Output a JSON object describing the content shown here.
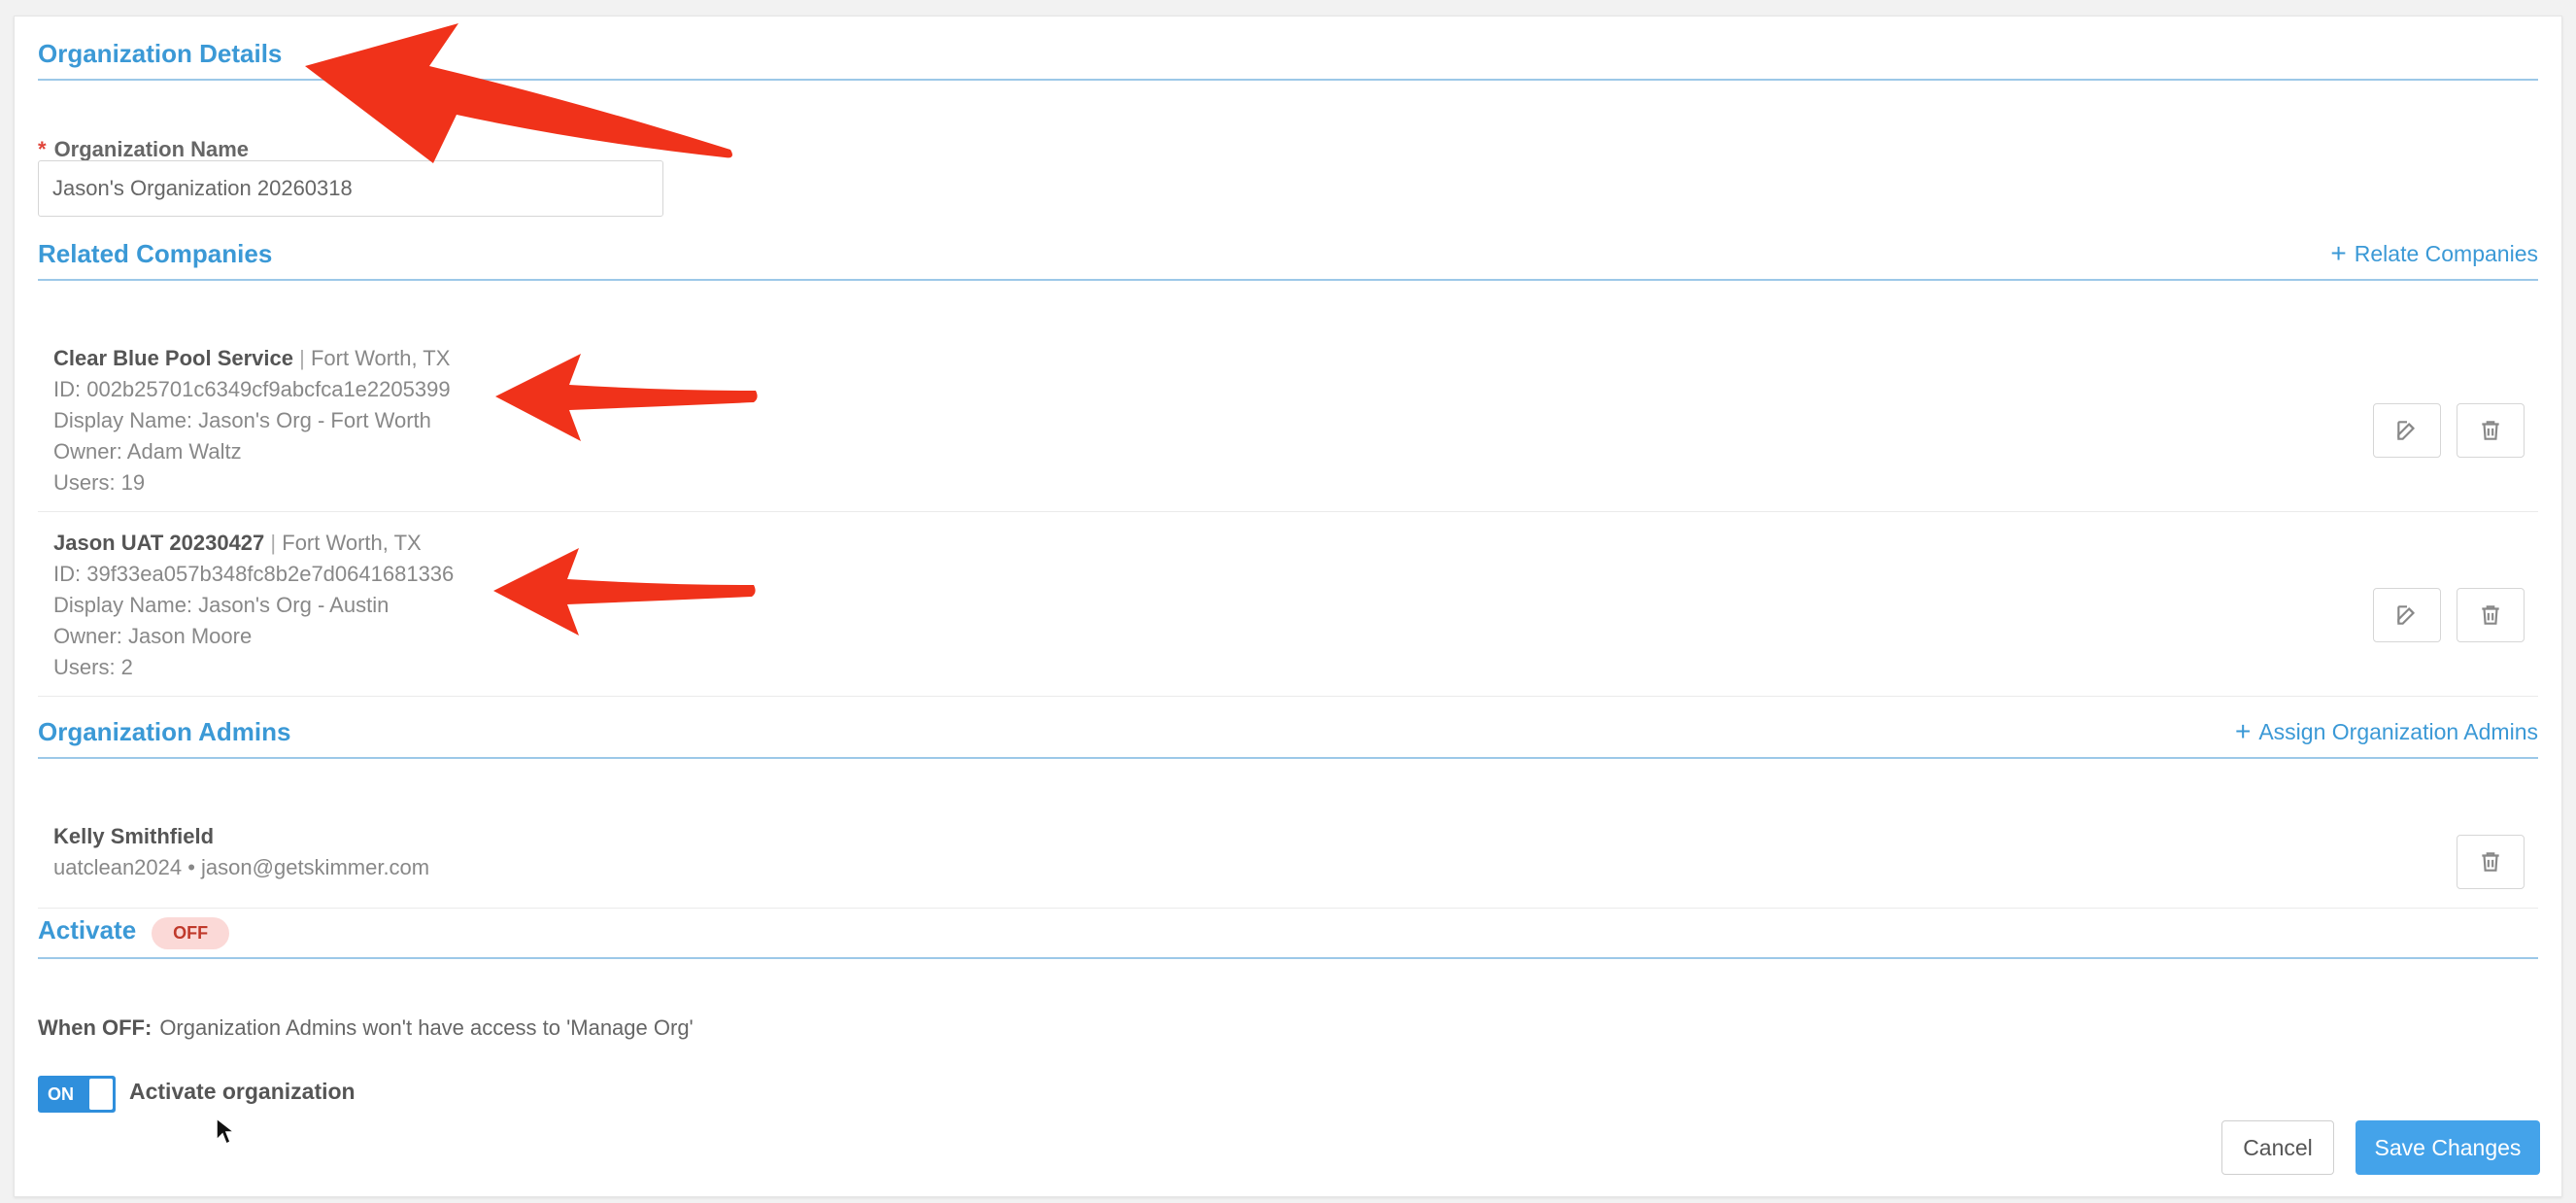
{
  "org_details": {
    "title": "Organization Details",
    "name_label": "Organization Name",
    "required_mark": "*",
    "name_value": "Jason's Organization 20260318"
  },
  "related_companies": {
    "title": "Related Companies",
    "action_label": "Relate Companies",
    "items": [
      {
        "name": "Clear Blue Pool Service",
        "sep": "|",
        "location": "Fort Worth, TX",
        "id_line": "ID: 002b25701c6349cf9abcfca1e2205399",
        "display_line": "Display Name: Jason's Org - Fort Worth",
        "owner_line": "Owner: Adam Waltz",
        "users_line": "Users: 19"
      },
      {
        "name": "Jason UAT 20230427",
        "sep": "|",
        "location": "Fort Worth, TX",
        "id_line": "ID: 39f33ea057b348fc8b2e7d0641681336",
        "display_line": "Display Name: Jason's Org - Austin",
        "owner_line": "Owner: Jason Moore",
        "users_line": "Users: 2"
      }
    ]
  },
  "org_admins": {
    "title": "Organization Admins",
    "action_label": "Assign Organization Admins",
    "items": [
      {
        "name": "Kelly Smithfield",
        "detail": "uatclean2024 • jason@getskimmer.com"
      }
    ]
  },
  "activate": {
    "title": "Activate",
    "status_badge": "OFF",
    "when_off_label": "When OFF:",
    "when_off_text": "Organization Admins won't have access to 'Manage Org'",
    "toggle_text": "ON",
    "toggle_label": "Activate organization"
  },
  "footer": {
    "cancel_label": "Cancel",
    "save_label": "Save Changes"
  },
  "colors": {
    "accent": "#3b99d6",
    "primary_button": "#44a3ea",
    "annotation_arrow": "#f0321a",
    "off_badge_bg": "#fbd9d7"
  },
  "icons": [
    "plus-icon",
    "edit-icon",
    "trash-icon",
    "mouse-cursor-icon",
    "annotation-arrow"
  ]
}
